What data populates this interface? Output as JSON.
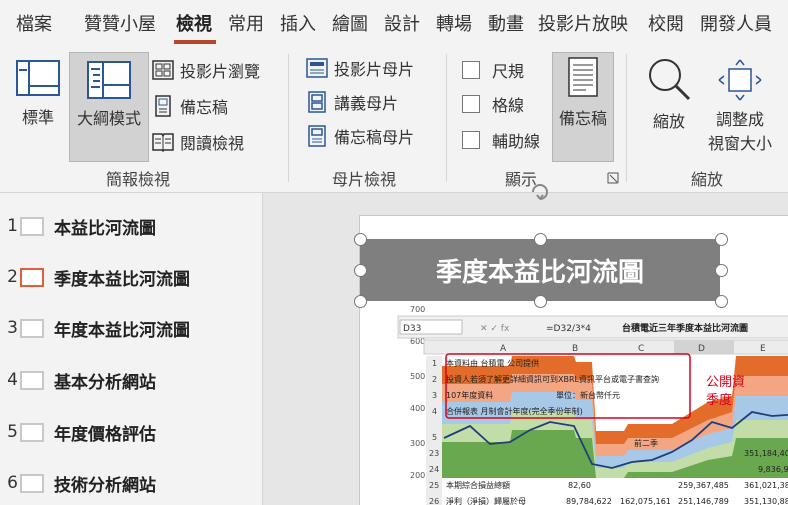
{
  "tabs": [
    "檔案",
    "贊贊小屋",
    "檢視",
    "常用",
    "插入",
    "繪圖",
    "設計",
    "轉場",
    "動畫",
    "投影片放映",
    "校閱",
    "開發人員"
  ],
  "active_tab": "檢視",
  "ribbon": {
    "presentation_views": {
      "label": "簡報檢視",
      "normal": "標準",
      "outline": "大綱模式",
      "slide_sorter": "投影片瀏覽",
      "notes_page": "備忘稿",
      "reading_view": "閱讀檢視"
    },
    "master_views": {
      "label": "母片檢視",
      "slide_master": "投影片母片",
      "handout_master": "講義母片",
      "notes_master": "備忘稿母片"
    },
    "show": {
      "label": "顯示",
      "ruler": "尺規",
      "gridlines": "格線",
      "guides": "輔助線",
      "notes": "備忘稿"
    },
    "zoom": {
      "label": "縮放",
      "zoom": "縮放",
      "fit_line1": "調整成",
      "fit_line2": "視窗大小"
    }
  },
  "outline": [
    {
      "num": "1",
      "title": "本益比河流圖"
    },
    {
      "num": "2",
      "title": "季度本益比河流圖"
    },
    {
      "num": "3",
      "title": "年度本益比河流圖"
    },
    {
      "num": "4",
      "title": "基本分析網站"
    },
    {
      "num": "5",
      "title": "年度價格評估"
    },
    {
      "num": "6",
      "title": "技術分析網站"
    }
  ],
  "slide": {
    "title": "季度本益比河流圖",
    "sheet": {
      "name_box": "D33",
      "formula": "=D32/3*4",
      "chart_title": "台積電近三年季度本益比河流圖",
      "col_headers": [
        "A",
        "B",
        "C",
        "D",
        "E"
      ],
      "row_numbers": [
        "1",
        "2",
        "3",
        "4",
        "5",
        "23",
        "24",
        "25",
        "26"
      ],
      "y_ticks": [
        "700",
        "600",
        "500",
        "400",
        "300",
        "200"
      ],
      "rows": [
        "本資料由 台積電 公司提供",
        "投資人若須了解更詳細資訊可到XBRL資訊平台或電子書查詢",
        "107年度資料",
        "單位：新台幣仟元",
        "合併報表 月制會計年度(完全季份年制)"
      ],
      "callout": "公開資",
      "callout2": "季度",
      "quarter_label": "前二季",
      "row25_label": "本期綜合損益總額",
      "row26_label": "淨利（淨損）歸屬於母",
      "values": {
        "b25": "82,60",
        "b26": "89,784,622",
        "c26": "162,075,161",
        "d25": "259,367,485",
        "d26": "251,146,789",
        "e23": "351,184,40",
        "e24": "9,836,97",
        "e25": "361,021,38",
        "e26": "351,130,88"
      }
    }
  },
  "colors": {
    "accent": "#b7472a",
    "title_fill": "#7f7f7f"
  }
}
